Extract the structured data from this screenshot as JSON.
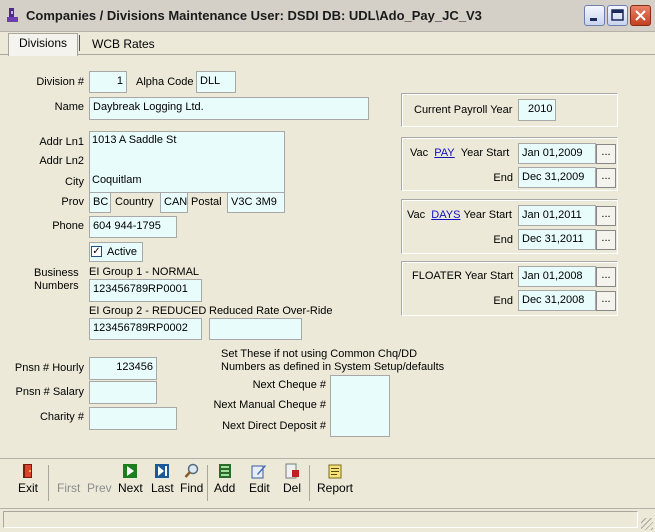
{
  "window": {
    "title": "Companies / Divisions Maintenance   User: DSDI   DB: UDL\\Ado_Pay_JC_V3"
  },
  "tabs": [
    {
      "label": "Divisions"
    },
    {
      "label": "WCB Rates"
    }
  ],
  "labels": {
    "division": "Division #",
    "alpha_code": "Alpha Code",
    "name": "Name",
    "addr1": "Addr Ln1",
    "addr2": "Addr Ln2",
    "city": "City",
    "prov": "Prov",
    "country": "Country",
    "postal": "Postal",
    "phone": "Phone",
    "active": "Active",
    "business_numbers_1": "Business",
    "business_numbers_2": "Numbers",
    "ei_group1": "EI Group 1 - NORMAL",
    "ei_group2": "EI Group 2 - REDUCED",
    "reduced_rate": "Reduced Rate Over-Ride",
    "pnsn_hourly": "Pnsn # Hourly",
    "pnsn_salary": "Pnsn # Salary",
    "charity": "Charity #",
    "set_these_1": "Set These if not using Common Chq/DD",
    "set_these_2": "Numbers as defined in System Setup/defaults",
    "next_cheque": "Next Cheque #",
    "next_manual_cheque": "Next Manual Cheque #",
    "next_direct_deposit": "Next Direct Deposit #",
    "current_payroll_year": "Current Payroll Year",
    "vac_pay_prefix": "Vac",
    "vac_pay_link": "PAY",
    "vac_pay_suffix": "Year Start",
    "vac_days_prefix": "Vac",
    "vac_days_link": "DAYS",
    "vac_days_suffix": "Year Start",
    "floater_start": "FLOATER Year Start",
    "end": "End"
  },
  "fields": {
    "division": "1",
    "alpha_code": "DLL",
    "name": "Daybreak Logging Ltd.",
    "addr1": "1013 A Saddle St",
    "addr2": "",
    "city": "Coquitlam",
    "prov": "BC",
    "country": "CAN",
    "postal": "V3C 3M9",
    "phone": "604 944-1795",
    "active": true,
    "ei_group1": "123456789RP0001",
    "ei_group2": "123456789RP0002",
    "reduced_rate": "",
    "pnsn_hourly": "123456",
    "pnsn_salary": "",
    "charity": "",
    "next_cheque": "",
    "next_manual_cheque": "",
    "next_direct_deposit": "",
    "current_payroll_year": "2010",
    "vac_pay_start": "Jan 01,2009",
    "vac_pay_end": "Dec 31,2009",
    "vac_days_start": "Jan 01,2011",
    "vac_days_end": "Dec 31,2011",
    "floater_start": "Jan 01,2008",
    "floater_end": "Dec 31,2008",
    "ellipsis": "..."
  },
  "active_check": "✓",
  "toolbar": [
    {
      "label": "Exit",
      "icon": "exit-icon",
      "enabled": true
    },
    {
      "label": "First",
      "icon": "first-icon",
      "enabled": false
    },
    {
      "label": "Prev",
      "icon": "prev-icon",
      "enabled": false
    },
    {
      "label": "Next",
      "icon": "next-icon",
      "enabled": true
    },
    {
      "label": "Last",
      "icon": "last-icon",
      "enabled": true
    },
    {
      "label": "Find",
      "icon": "find-icon",
      "enabled": true
    },
    {
      "label": "Add",
      "icon": "add-icon",
      "enabled": true
    },
    {
      "label": "Edit",
      "icon": "edit-icon",
      "enabled": true
    },
    {
      "label": "Del",
      "icon": "delete-icon",
      "enabled": true
    },
    {
      "label": "Report",
      "icon": "report-icon",
      "enabled": true
    }
  ],
  "colors": {
    "field_bg": "#e8fcfc",
    "window_bg": "#ece9d8",
    "link": "#1010c0"
  }
}
